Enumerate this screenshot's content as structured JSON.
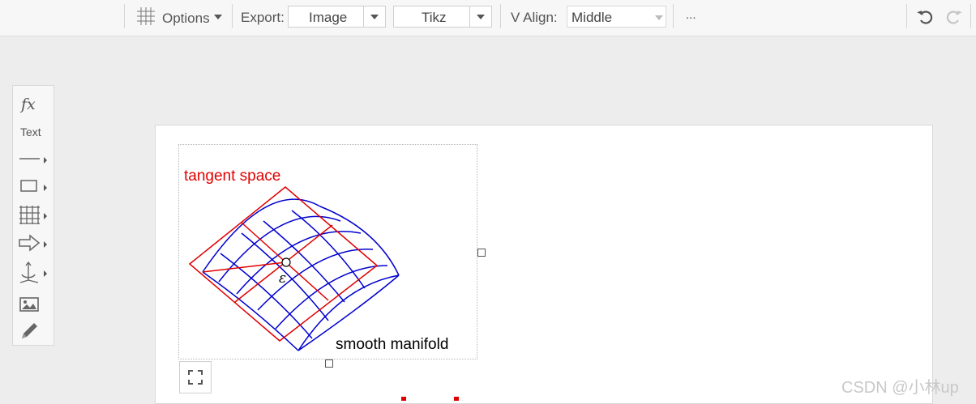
{
  "toolbar": {
    "options_label": "Options",
    "export_label": "Export:",
    "export_image": "Image",
    "export_tikz": "Tikz",
    "valign_label": "V Align:",
    "valign_value": "Middle",
    "more_label": "..."
  },
  "sidebar": {
    "fx_label": "fx",
    "text_label": "Text",
    "tools": [
      "line-icon",
      "rectangle-icon",
      "grid-icon",
      "arrow-icon",
      "axes-icon",
      "image-icon",
      "pencil-icon"
    ]
  },
  "figure": {
    "tangent_label": "tangent space",
    "manifold_label": "smooth manifold",
    "point_label": "ε",
    "colors": {
      "tangent": "#e00000",
      "manifold": "#0000d0",
      "point": "#000000"
    }
  },
  "watermark": "CSDN @小林up"
}
